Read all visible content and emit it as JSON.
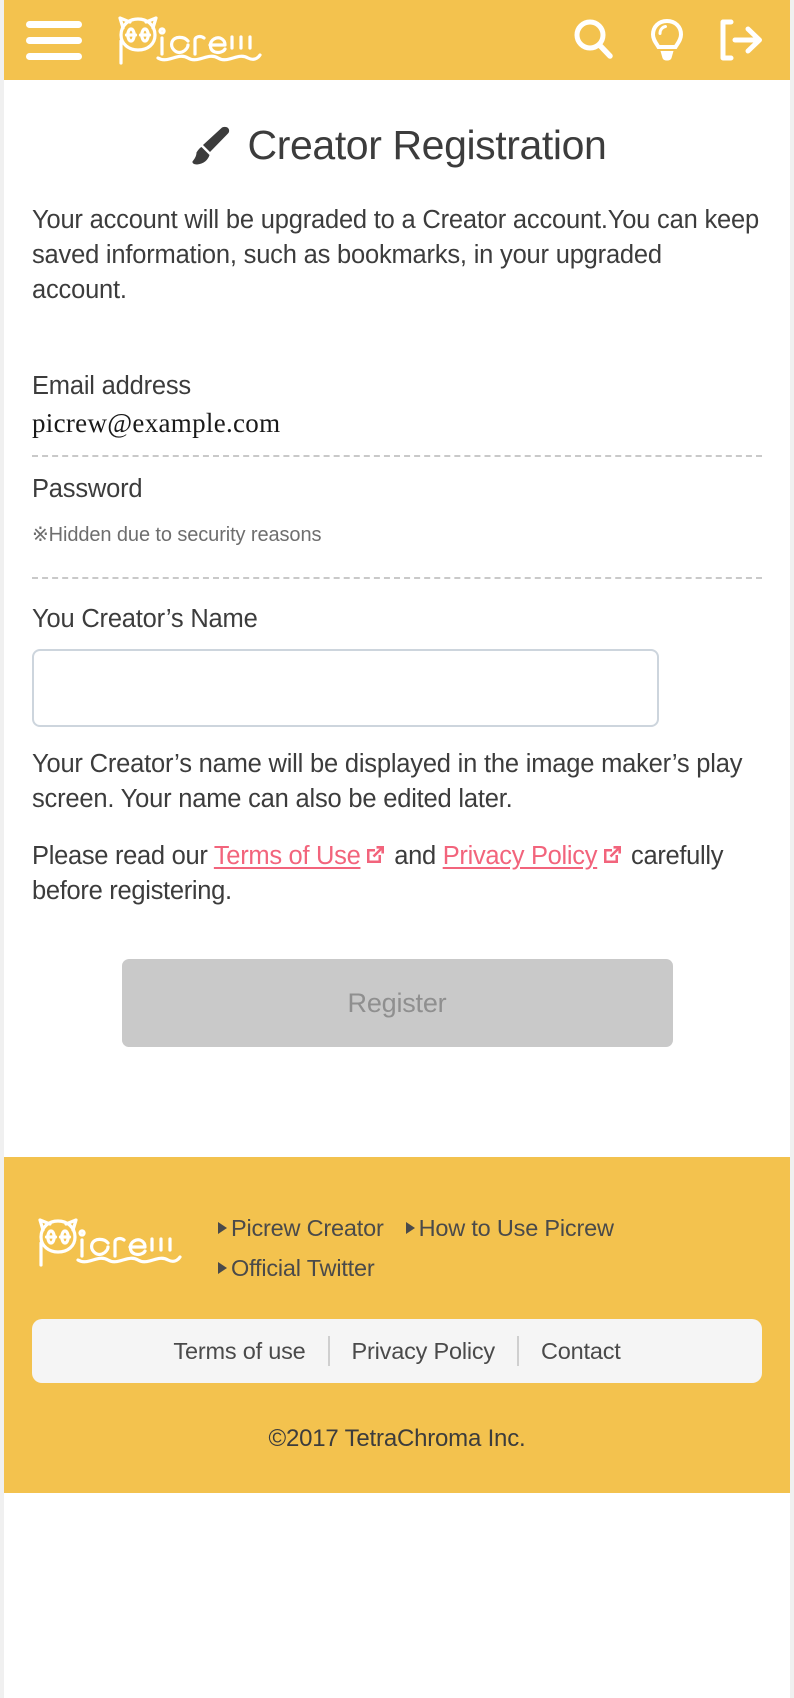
{
  "header": {
    "menu_icon": "hamburger-menu-icon",
    "logo_text": "picrew",
    "icons": [
      {
        "name": "search-icon",
        "label": "Search"
      },
      {
        "name": "lightbulb-icon",
        "label": "Ideas"
      },
      {
        "name": "logout-icon",
        "label": "Log out"
      }
    ]
  },
  "main": {
    "title_icon": "paintbrush-icon",
    "title": "Creator Registration",
    "lead": "Your account will be upgraded to a Creator account.You can keep saved information, such as bookmarks, in your upgraded account.",
    "email": {
      "label": "Email address",
      "value": "picrew@example.com"
    },
    "password": {
      "label": "Password",
      "note": "※Hidden due to security reasons"
    },
    "creator_name": {
      "label": "You Creator’s Name",
      "value": "",
      "placeholder": "",
      "help": "Your Creator’s name will be displayed in the image maker’s play screen. Your name can also be edited later."
    },
    "terms_line": {
      "prefix": "Please read our ",
      "terms_link": "Terms of Use",
      "middle": " and ",
      "privacy_link": "Privacy Policy",
      "suffix": " carefully before registering."
    },
    "register_label": "Register"
  },
  "footer": {
    "logo_text": "picrew",
    "links": [
      {
        "label": "Picrew Creator"
      },
      {
        "label": "How to Use Picrew"
      },
      {
        "label": "Official Twitter"
      }
    ],
    "bar_links": [
      {
        "label": "Terms of use"
      },
      {
        "label": "Privacy Policy"
      },
      {
        "label": "Contact"
      }
    ],
    "copyright": "©2017 TetraChroma Inc."
  },
  "colors": {
    "brand_yellow": "#F3C24E",
    "link_pink": "#F2647C",
    "text_dark": "#3c3c3c",
    "button_disabled": "#c9c9c9"
  }
}
